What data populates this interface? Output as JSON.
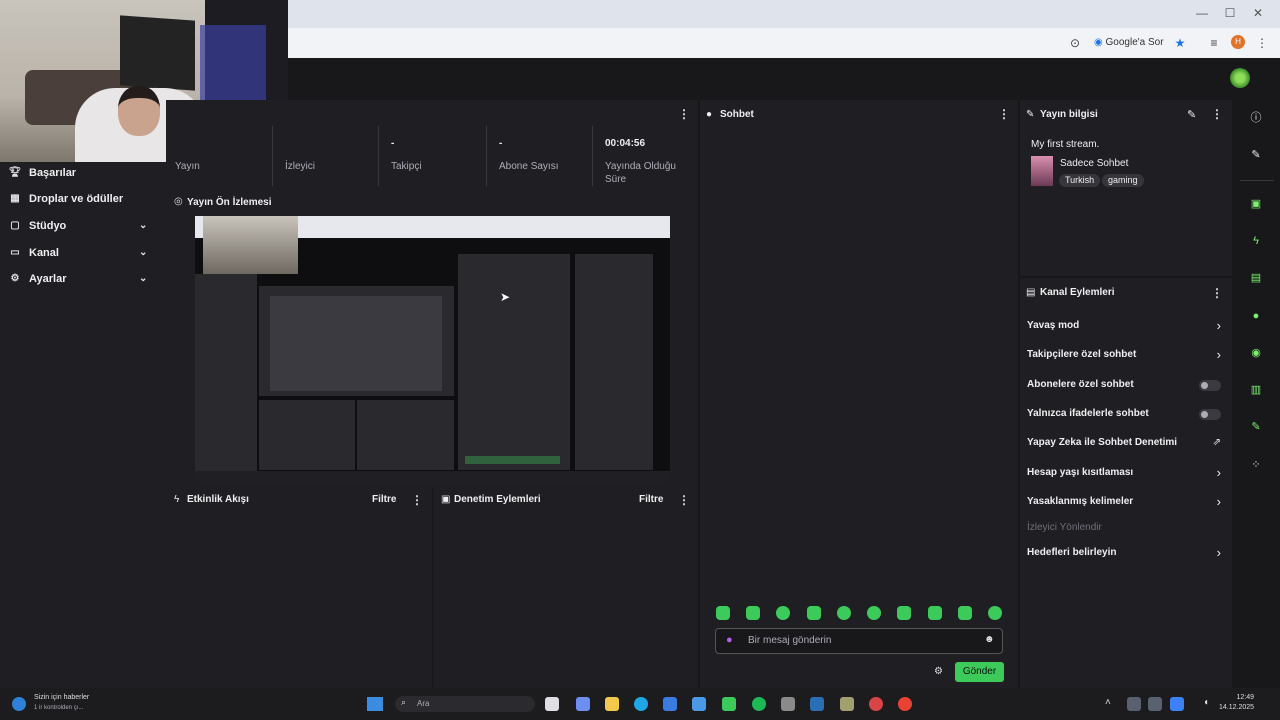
{
  "browser": {
    "google_lens_label": "Google'a Sor",
    "profile_initial": "H"
  },
  "sidebar": {
    "items": [
      {
        "label": "Başarılar",
        "icon": "trophy-icon"
      },
      {
        "label": "Droplar ve ödüller",
        "icon": "gift-icon"
      },
      {
        "label": "Stüdyo",
        "icon": "studio-icon"
      },
      {
        "label": "Kanal",
        "icon": "channel-icon"
      },
      {
        "label": "Ayarlar",
        "icon": "gear-icon"
      }
    ]
  },
  "stats": {
    "items": [
      {
        "value": "",
        "label": "Yayın"
      },
      {
        "value": "",
        "label": "İzleyici"
      },
      {
        "value": "-",
        "label": "Takipçi"
      },
      {
        "value": "-",
        "label": "Abone Sayısı"
      },
      {
        "value": "00:04:56",
        "label": "Yayında Olduğu Süre"
      }
    ]
  },
  "preview": {
    "title": "Yayın Ön İzlemesi"
  },
  "event_feed": {
    "title": "Etkinlik Akışı",
    "filter_label": "Filtre"
  },
  "mod_actions": {
    "title": "Denetim Eylemleri",
    "filter_label": "Filtre"
  },
  "chat": {
    "title": "Sohbet",
    "input_placeholder": "Bir mesaj gönderin",
    "send_label": "Gönder"
  },
  "stream_info": {
    "title": "Yayın bilgisi",
    "stream_title": "My first stream.",
    "category": "Sadece Sohbet",
    "tags": [
      "Turkish",
      "gaming"
    ]
  },
  "channel_actions": {
    "title": "Kanal Eylemleri",
    "items": [
      {
        "label": "Yavaş mod",
        "control": "arrow"
      },
      {
        "label": "Takipçilere özel sohbet",
        "control": "arrow"
      },
      {
        "label": "Abonelere özel sohbet",
        "control": "toggle",
        "on": false
      },
      {
        "label": "Yalnızca ifadelerle sohbet",
        "control": "toggle",
        "on": false
      },
      {
        "label": "Yapay Zeka ile Sohbet Denetimi",
        "control": "external"
      },
      {
        "label": "Hesap yaşı kısıtlaması",
        "control": "arrow"
      },
      {
        "label": "Yasaklanmış kelimeler",
        "control": "arrow"
      }
    ],
    "section_label": "İzleyici Yönlendir",
    "goals_label": "Hedefleri belirleyin"
  },
  "taskbar": {
    "news_line1": "Sizin için haberler",
    "news_line2": "1 ir kontrolden çı...",
    "search_label": "Ara",
    "time": "12:49",
    "date": "14.12.2025"
  },
  "colors": {
    "accent_green": "#3ccb5a",
    "panel_bg": "#1f1f23",
    "page_bg": "#18181b"
  }
}
